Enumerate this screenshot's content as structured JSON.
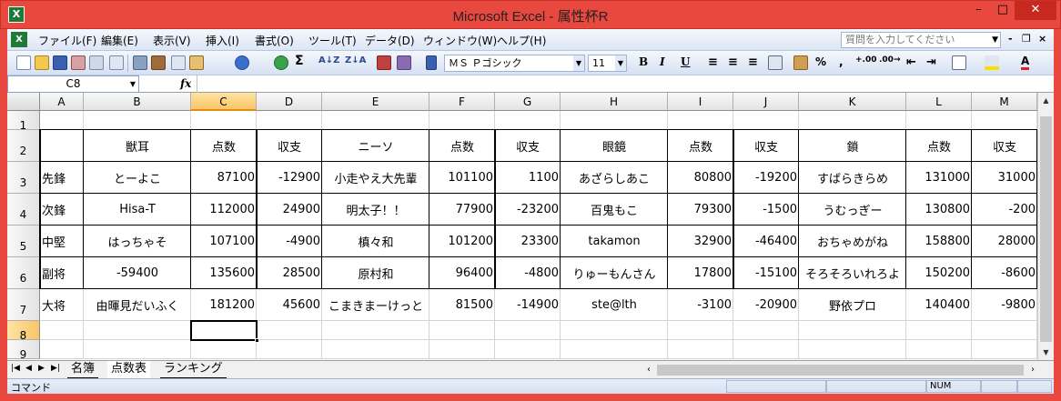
{
  "window": {
    "title": "Microsoft Excel - 属性杯R",
    "min": "–",
    "max": "□",
    "close": "✕"
  },
  "menubar": {
    "items": [
      "ファイル(F)",
      "編集(E)",
      "表示(V)",
      "挿入(I)",
      "書式(O)",
      "ツール(T)",
      "データ(D)",
      "ウィンドウ(W)",
      "ヘルプ(H)"
    ],
    "help_placeholder": "質問を入力してください",
    "mdi_min": "-",
    "mdi_restore": "❐",
    "mdi_close": "×"
  },
  "toolbar": {
    "font_name": "ＭＳ Ｐゴシック",
    "font_size": "11",
    "bold": "B",
    "italic": "I",
    "underline": "U",
    "percent": "%",
    "comma": ",",
    "sigma": "Σ",
    "font_color": "#e02020",
    "fill_color": "#f5e000"
  },
  "formula_bar": {
    "name_box": "C8",
    "fx": "fx",
    "formula": ""
  },
  "columns": [
    "A",
    "B",
    "C",
    "D",
    "E",
    "F",
    "G",
    "H",
    "I",
    "J",
    "K",
    "L",
    "M"
  ],
  "rows": [
    "1",
    "2",
    "3",
    "4",
    "5",
    "6",
    "7",
    "8",
    "9"
  ],
  "selected_cell": "C8",
  "table": {
    "headers": [
      "",
      "獣耳",
      "点数",
      "収支",
      "ニーソ",
      "点数",
      "収支",
      "眼鏡",
      "点数",
      "収支",
      "鎖",
      "点数",
      "収支"
    ],
    "body": [
      [
        "先鋒",
        "とーよこ",
        "87100",
        "-12900",
        "小走やえ大先輩",
        "101100",
        "1100",
        "あざらしあこ",
        "80800",
        "-19200",
        "すばらきらめ",
        "131000",
        "31000"
      ],
      [
        "次鋒",
        "Hisa-T",
        "112000",
        "24900",
        "明太子！！",
        "77900",
        "-23200",
        "百鬼もこ",
        "79300",
        "-1500",
        "うむっぎー",
        "130800",
        "-200"
      ],
      [
        "中堅",
        "はっちゃそ",
        "107100",
        "-4900",
        "槙々和",
        "101200",
        "23300",
        "takamon",
        "32900",
        "-46400",
        "おちゃめがね",
        "158800",
        "28000"
      ],
      [
        "副将",
        "-59400",
        "135600",
        "28500",
        "原村和",
        "96400",
        "-4800",
        "りゅーもんさん",
        "17800",
        "-15100",
        "そろそろいれろよ",
        "150200",
        "-8600"
      ],
      [
        "大将",
        "由暉見だいふく",
        "181200",
        "45600",
        "こまきまーけっと",
        "81500",
        "-14900",
        "ste@lth",
        "-3100",
        "-20900",
        "野依プロ",
        "140400",
        "-9800"
      ]
    ]
  },
  "sheets": {
    "tabs": [
      "名簿",
      "点数表",
      "ランキング"
    ],
    "active": "点数表",
    "nav": [
      "|◀",
      "◀",
      "▶",
      "▶|"
    ]
  },
  "status": {
    "mode": "コマンド",
    "num": "NUM"
  }
}
